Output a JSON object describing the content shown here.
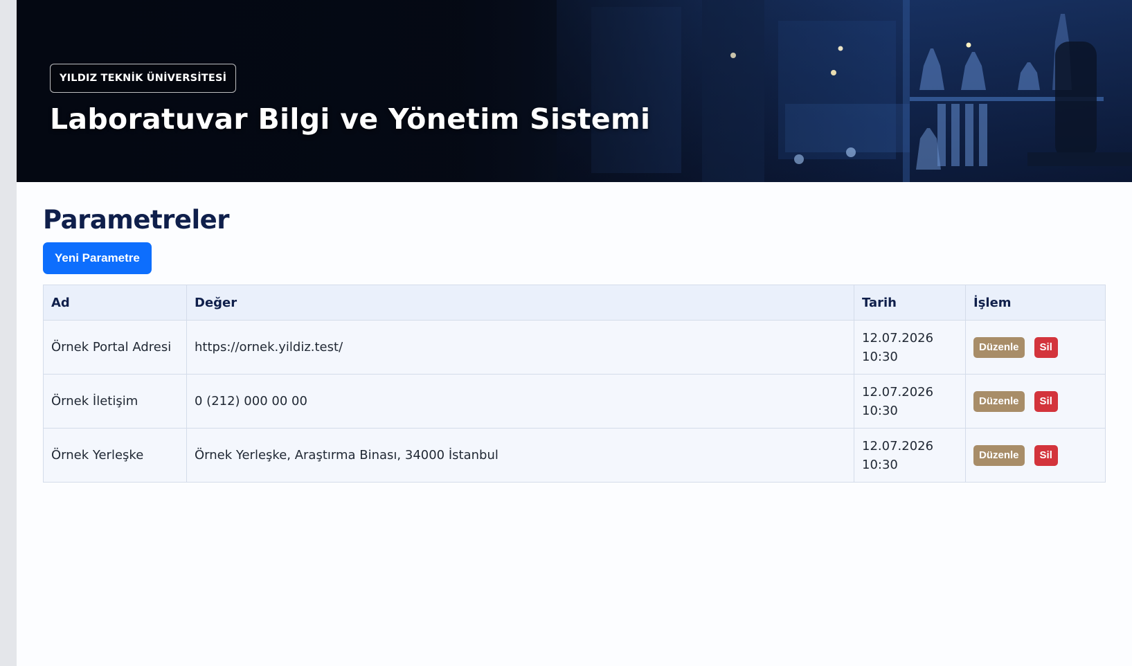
{
  "header": {
    "badge": "YILDIZ TEKNİK ÜNİVERSİTESİ",
    "title": "Laboratuvar Bilgi ve Yönetim Sistemi"
  },
  "page": {
    "title": "Parametreler",
    "new_button": "Yeni Parametre"
  },
  "table": {
    "headers": [
      "Ad",
      "Değer",
      "Tarih",
      "İşlem"
    ],
    "rows": [
      {
        "ad": "Örnek Portal Adresi",
        "deger": "https://ornek.yildiz.test/",
        "tarih": "12.07.2026",
        "saat": "10:30",
        "edit": "Düzenle",
        "del": "Sil"
      },
      {
        "ad": "Örnek İletişim",
        "deger": "0 (212) 000 00 00",
        "tarih": "12.07.2026",
        "saat": "10:30",
        "edit": "Düzenle",
        "del": "Sil"
      },
      {
        "ad": "Örnek Yerleşke",
        "deger": "Örnek Yerleşke, Araştırma Binası, 34000 İstanbul",
        "tarih": "12.07.2026",
        "saat": "10:30",
        "edit": "Düzenle",
        "del": "Sil"
      }
    ]
  },
  "colors": {
    "primary": "#0d6efd",
    "edit": "#a88d68",
    "delete": "#d3343c",
    "heading": "#0f1f4b",
    "hero_dark": "#060b17"
  },
  "hero_image": "laboratory-glassware-microscope-background"
}
